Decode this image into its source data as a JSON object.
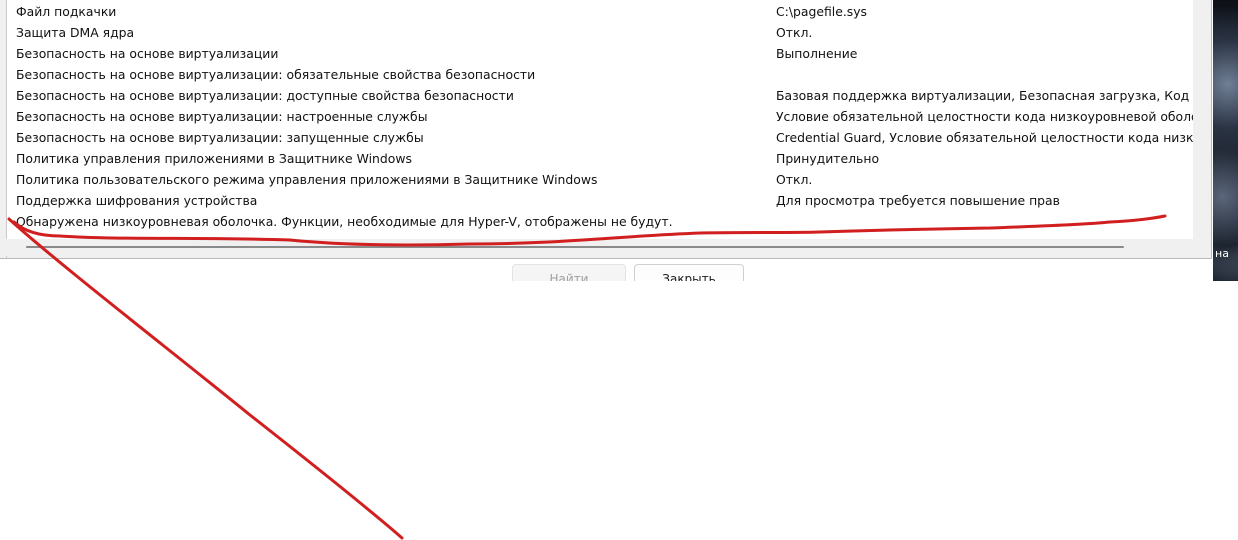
{
  "list": {
    "rows": [
      {
        "item": "Файл подкачки",
        "value": "C:\\pagefile.sys"
      },
      {
        "item": "Защита DMA ядра",
        "value": "Откл."
      },
      {
        "item": "Безопасность на основе виртуализации",
        "value": "Выполнение"
      },
      {
        "item": "Безопасность на основе виртуализации: обязательные свойства безопасности",
        "value": ""
      },
      {
        "item": "Безопасность на основе виртуализации: доступные свойства безопасности",
        "value": "Базовая поддержка виртуализации, Безопасная загрузка, Код UEFI то"
      },
      {
        "item": "Безопасность на основе виртуализации: настроенные службы",
        "value": "Условие обязательной целостности кода низкоуровневой оболочки"
      },
      {
        "item": "Безопасность на основе виртуализации: запущенные службы",
        "value": "Credential Guard, Условие обязательной целостности кода низкоуров"
      },
      {
        "item": "Политика управления приложениями в Защитнике Windows",
        "value": "Принудительно"
      },
      {
        "item": "Политика пользовательского режима управления приложениями в Защитнике Windows",
        "value": "Откл."
      },
      {
        "item": "Поддержка шифрования устройства",
        "value": "Для просмотра требуется повышение прав"
      },
      {
        "item": "Обнаружена низкоуровневая оболочка. Функции, необходимые для Hyper-V, отображены не будут.",
        "value": ""
      }
    ]
  },
  "buttons": {
    "find_label": "Найти",
    "close_label": "Закрыть"
  },
  "desktop": {
    "fragment_text": "на"
  },
  "annotation": {
    "color": "#d11f1f",
    "underline": "red hand-drawn underline beneath the last row",
    "arrow": "red hand-drawn line pointing to the last row"
  }
}
